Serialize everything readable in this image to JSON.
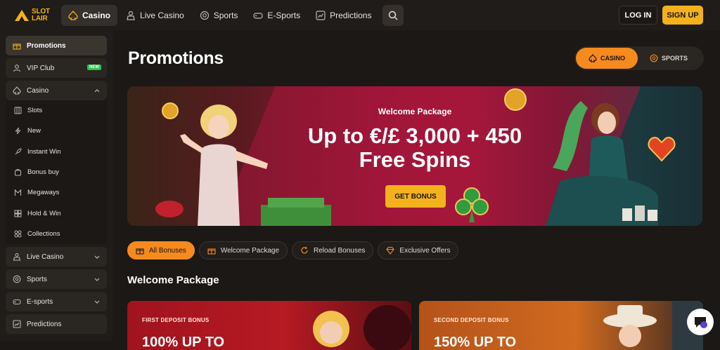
{
  "brand": {
    "line1": "SLOT",
    "line2": "LAIR"
  },
  "nav": {
    "items": [
      {
        "label": "Casino",
        "icon": "spade-icon"
      },
      {
        "label": "Live Casino",
        "icon": "dealer-icon"
      },
      {
        "label": "Sports",
        "icon": "ball-icon"
      },
      {
        "label": "E-Sports",
        "icon": "gamepad-icon"
      },
      {
        "label": "Predictions",
        "icon": "chart-icon"
      }
    ],
    "search_icon": "search-icon"
  },
  "auth": {
    "login": "LOG IN",
    "signup": "SIGN UP"
  },
  "sidebar": {
    "promotions": "Promotions",
    "vip": "VIP Club",
    "vip_badge": "NEW",
    "casino": "Casino",
    "casino_sub": [
      "Slots",
      "New",
      "Instant Win",
      "Bonus buy",
      "Megaways",
      "Hold & Win",
      "Collections"
    ],
    "live_casino": "Live Casino",
    "sports": "Sports",
    "esports": "E-sports",
    "predictions": "Predictions"
  },
  "main": {
    "title": "Promotions",
    "toggle": {
      "casino": "CASINO",
      "sports": "SPORTS"
    },
    "hero": {
      "sub": "Welcome Package",
      "title_line1": "Up to €/£ 3,000 + 450",
      "title_line2": "Free Spins",
      "button": "GET BONUS"
    },
    "filters": [
      "All Bonuses",
      "Welcome Package",
      "Reload Bonuses",
      "Exclusive Offers"
    ],
    "section_title": "Welcome Package",
    "cards": [
      {
        "label": "FIRST DEPOSIT BONUS",
        "big": "100% UP TO"
      },
      {
        "label": "SECOND DEPOSIT BONUS",
        "big": "150% UP TO"
      }
    ]
  },
  "colors": {
    "accent_orange": "#f58a1e",
    "accent_yellow": "#f2b11d",
    "bg": "#1b1815",
    "new_badge": "#29c34c"
  }
}
